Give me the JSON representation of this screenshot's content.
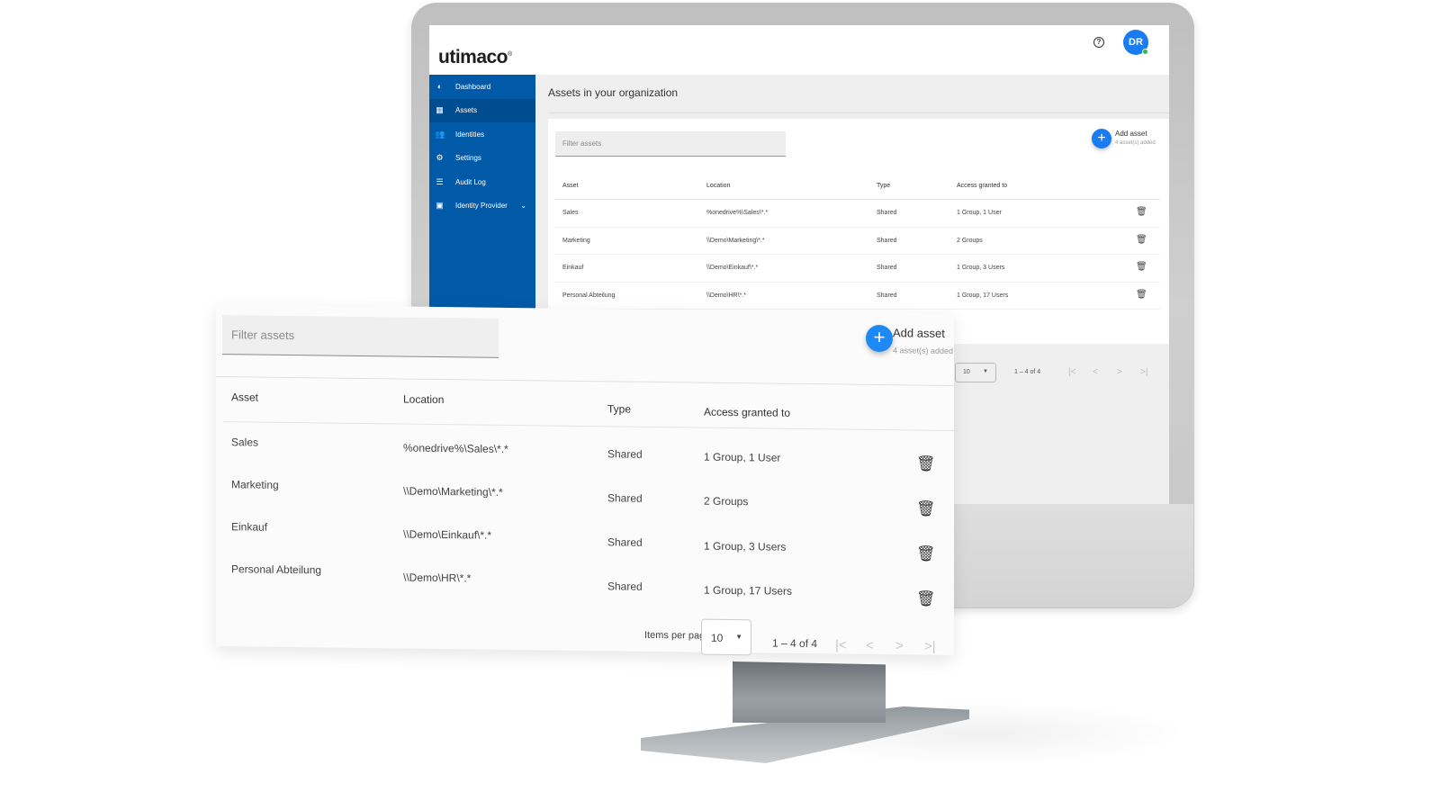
{
  "app": {
    "logo": "utimaco",
    "logo_mark": "®",
    "help_icon": "?",
    "user_initials": "DR",
    "colors": {
      "brand_blue": "#005aa8",
      "accent_blue": "#1a7cf0",
      "online_green": "#3bb54a"
    }
  },
  "sidebar": {
    "items": [
      {
        "label": "Dashboard",
        "icon": "pie-chart-icon",
        "glyph": "◐"
      },
      {
        "label": "Assets",
        "icon": "assets-icon",
        "glyph": "▦"
      },
      {
        "label": "Identities",
        "icon": "users-icon",
        "glyph": "👥"
      },
      {
        "label": "Settings",
        "icon": "gear-icon",
        "glyph": "⚙"
      },
      {
        "label": "Audit Log",
        "icon": "list-icon",
        "glyph": "☰"
      },
      {
        "label": "Identity Provider",
        "icon": "badge-icon",
        "glyph": "▣",
        "chevron": "⌄"
      }
    ],
    "active_index": 1
  },
  "main": {
    "title": "Assets in your organization",
    "filter_placeholder": "Filter assets",
    "add_button": {
      "icon": "+",
      "label": "Add asset",
      "sub": "4 asset(s) added"
    },
    "table": {
      "headers": [
        "Asset",
        "Location",
        "Type",
        "Access granted to"
      ],
      "rows": [
        {
          "asset": "Sales",
          "location": "%onedrive%\\Sales\\*.*",
          "type": "Shared",
          "access": "1 Group, 1 User"
        },
        {
          "asset": "Marketing",
          "location": "\\\\Demo\\Marketing\\*.*",
          "type": "Shared",
          "access": "2 Groups"
        },
        {
          "asset": "Einkauf",
          "location": "\\\\Demo\\Einkauf\\*.*",
          "type": "Shared",
          "access": "1 Group, 3 Users"
        },
        {
          "asset": "Personal Abteilung",
          "location": "\\\\Demo\\HR\\*.*",
          "type": "Shared",
          "access": "1 Group, 17 Users"
        }
      ],
      "delete_icon": "🗑"
    },
    "pagination": {
      "items_per_page_label": "Items per page:",
      "items_per_page": "10",
      "dropdown_arrow": "▼",
      "range": "1 – 4 of 4",
      "first": "|<",
      "prev": "<",
      "next": ">",
      "last": ">|"
    }
  }
}
